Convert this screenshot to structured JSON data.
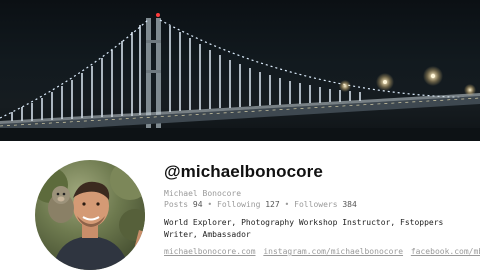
{
  "profile": {
    "handle": "@michaelbonocore",
    "full_name": "Michael Bonocore",
    "stats": {
      "posts_label": "Posts",
      "posts": "94",
      "following_label": "Following",
      "following": "127",
      "followers_label": "Followers",
      "followers": "384",
      "separator": "•"
    },
    "bio": "World Explorer, Photography Workshop Instructor, Fstoppers Writer, Ambassador",
    "links": [
      "michaelbonocore.com",
      "instagram.com/michaelbonocore",
      "facebook.com/mb"
    ]
  },
  "cover": {
    "subject": "night photo of illuminated suspension bridge"
  },
  "colors": {
    "handle": "#111111",
    "muted": "#9a9a9a",
    "text": "#222222",
    "bridge_light": "#e8f4ff"
  }
}
